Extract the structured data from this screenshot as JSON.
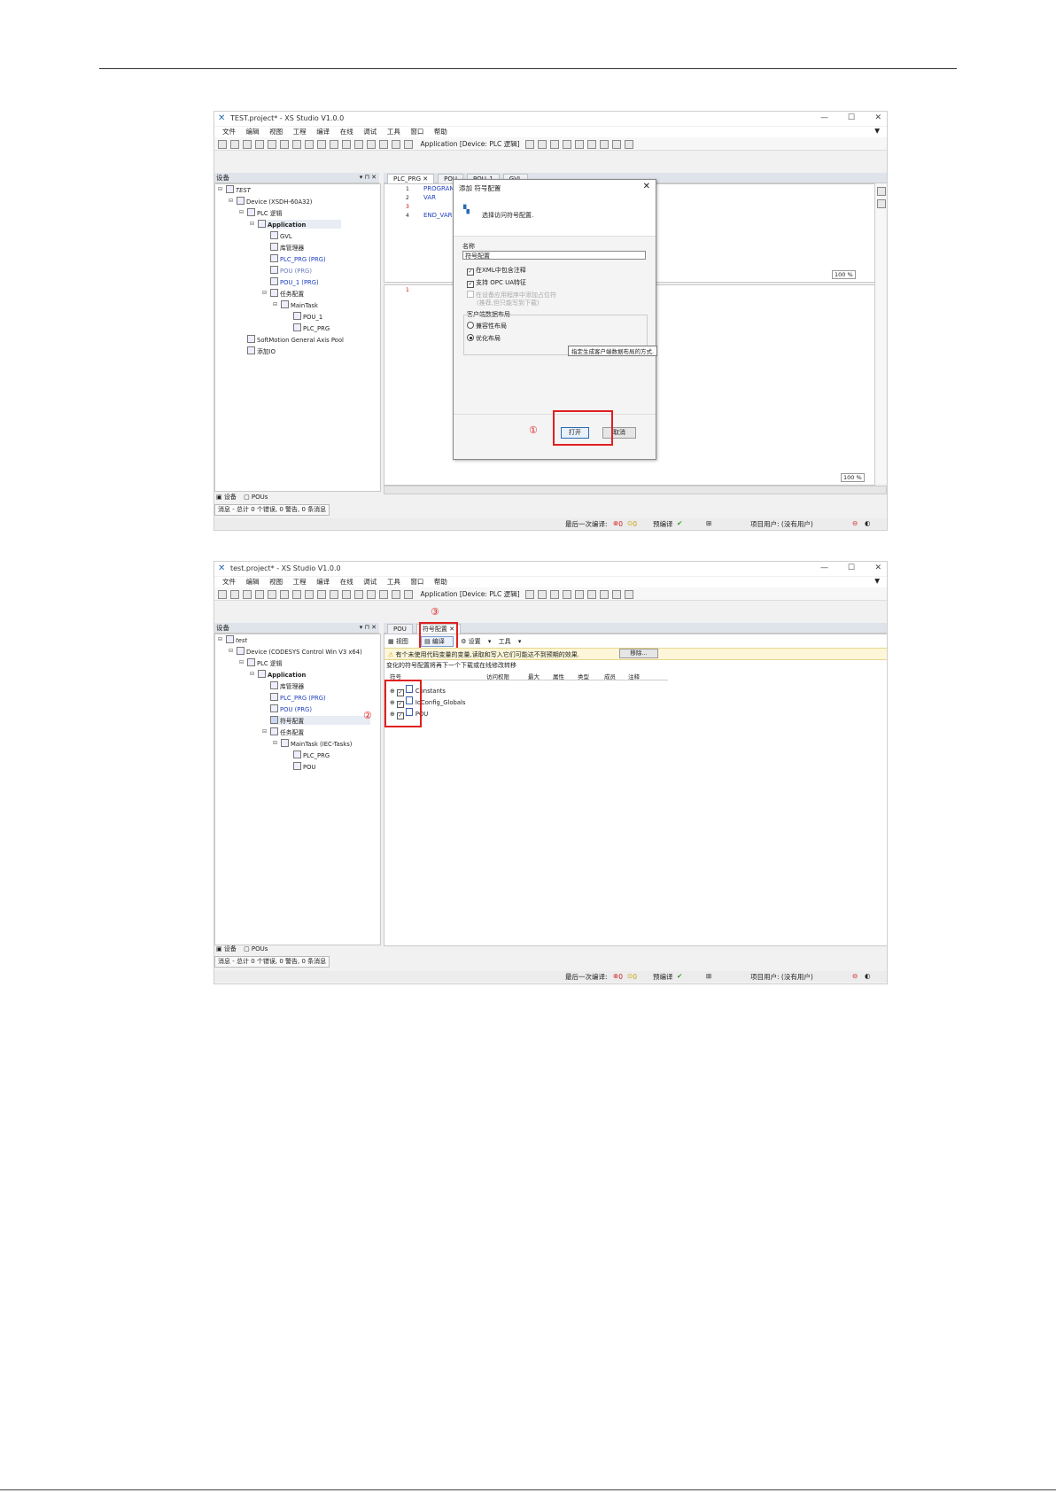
{
  "app_title_1": "TEST.project* - XS Studio V1.0.0",
  "app_title_2": "test.project* - XS Studio V1.0.0",
  "menu": [
    "文件",
    "编辑",
    "视图",
    "工程",
    "编译",
    "在线",
    "调试",
    "工具",
    "窗口",
    "帮助"
  ],
  "toolbar_app": "Application [Device: PLC 逻辑]",
  "devices_panel": "设备",
  "tree1": {
    "root": "TEST",
    "device": "Device (XSDH-60A32)",
    "plc": "PLC 逻辑",
    "application": "Application",
    "gvl": "GVL",
    "library": "库管理器",
    "plc_prg": "PLC_PRG (PRG)",
    "pou": "POU (PRG)",
    "pou1": "POU_1 (PRG)",
    "task_config": "任务配置",
    "maintask": "MainTask",
    "task_pou1": "POU_1",
    "task_plcprg": "PLC_PRG",
    "softmotion": "SoftMotion General Axis Pool",
    "ethercat": "添加IO"
  },
  "editor1": {
    "tabs": [
      "PLC_PRG",
      "POU",
      "POU_1",
      "GVL"
    ],
    "lines": [
      "PROGRAM",
      "VAR",
      "",
      "END_VAR"
    ],
    "zoom_top": "100 %",
    "zoom_bottom": "100 %"
  },
  "dialog": {
    "title": "添加 符号配置",
    "header_text": "选择访问符号配置.",
    "name_label": "名称",
    "name_value": "符号配置",
    "cb_xml": "在XML中包含注释",
    "cb_opc": "支持 OPC UA特征",
    "cb_disabled_1": "在设备应用程序中添加占位符",
    "cb_disabled_2": "(推荐,但只能写到下载)",
    "group_label": "客户端数据布局",
    "radio_compat": "兼容性布局",
    "radio_optimized": "优化布局",
    "tooltip": "指定生成客户端数据布局的方式.",
    "open": "打开",
    "cancel": "取消"
  },
  "bottom_tabs": [
    "设备",
    "POUs"
  ],
  "messages": "消息 - 总计 0 个错误, 0 警告, 0 条消息",
  "status": {
    "last_build": "最后一次编译:",
    "errors": "0",
    "warnings": "0",
    "precompile": "预编译",
    "project_user": "项目用户: (没有用户)"
  },
  "tree2": {
    "root": "test",
    "device": "Device (CODESYS Control Win V3 x64)",
    "plc": "PLC 逻辑",
    "application": "Application",
    "library": "库管理器",
    "plc_prg": "PLC_PRG (PRG)",
    "pou": "POU (PRG)",
    "symbol": "符号配置",
    "task_config": "任务配置",
    "maintask": "MainTask (IEC-Tasks)",
    "task_plcprg": "PLC_PRG",
    "task_pou": "POU"
  },
  "editor2": {
    "tabs": [
      "POU",
      "符号配置"
    ],
    "toolbar": [
      "视图",
      "编译",
      "设置",
      "工具"
    ],
    "info": "有个未使用代码变量的变量,读取和写入它们可能达不到预期的效果.",
    "remove": "移除...",
    "info2": "变化的符号配置将再下一个下载或在线修改转移",
    "columns": [
      "符号",
      "访问权限",
      "最大",
      "属性",
      "类型",
      "成员",
      "注释"
    ],
    "rows": [
      "Constants",
      "IoConfig_Globals",
      "POU"
    ]
  },
  "markers": [
    "①",
    "②",
    "③"
  ]
}
